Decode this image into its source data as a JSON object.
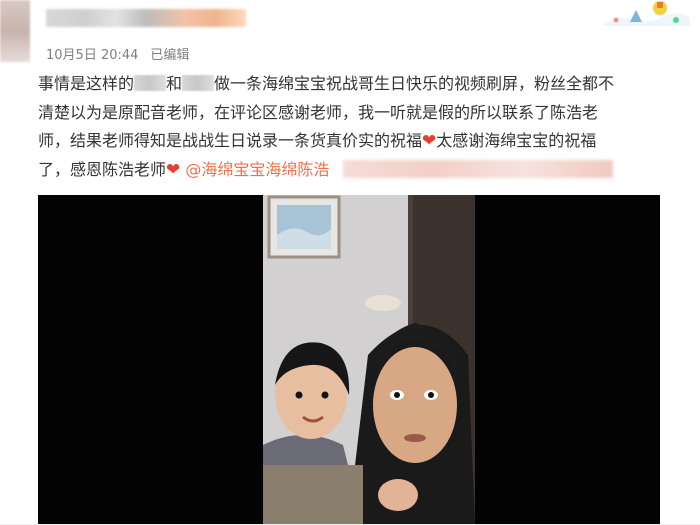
{
  "meta": {
    "date": "10月5日 20:44",
    "edited": "已编辑"
  },
  "post": {
    "line1_a": "事情是这样的",
    "line1_b": "和",
    "line1_c": "做一条海绵宝宝祝战哥生日快乐的视频刷屏，粉丝全都不",
    "line2": "清楚以为是原配音老师，在评论区感谢老师，我一听就是假的所以联系了陈浩老",
    "line3_a": "师，结果老师得知是战战生日说录一条货真价实的祝福",
    "line3_b": "太感谢海绵宝宝的祝福",
    "line4_a": "了，感恩陈浩老师",
    "heart": "❤",
    "mention": "@海绵宝宝海绵陈浩"
  },
  "icons": {
    "avatar": "avatar",
    "heart": "heart-emoji-icon",
    "decoration": "card-decoration-icon"
  },
  "colors": {
    "text": "#333333",
    "meta": "#808080",
    "link": "#eb7350",
    "heart": "#e8402e",
    "video_bg": "#030303"
  }
}
